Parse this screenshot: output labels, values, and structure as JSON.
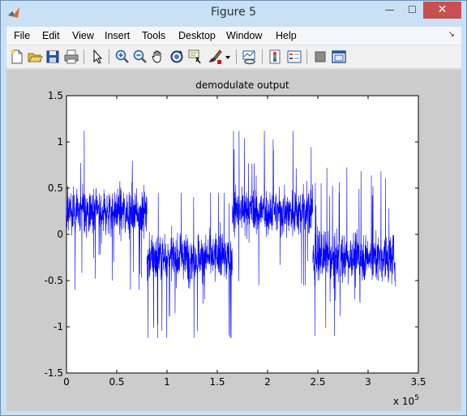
{
  "window": {
    "title": "Figure 5",
    "controls": {
      "minimize": "—",
      "maximize": "☐",
      "close": "✕"
    }
  },
  "menu": {
    "items": [
      "File",
      "Edit",
      "View",
      "Insert",
      "Tools",
      "Desktop",
      "Window",
      "Help"
    ],
    "dock_arrow": "↘"
  },
  "toolbar": {
    "buttons": [
      "new-figure-icon",
      "open-file-icon",
      "save-icon",
      "print-icon",
      "edit-plot-arrow-icon",
      "zoom-in-icon",
      "zoom-out-icon",
      "pan-hand-icon",
      "rotate-3d-icon",
      "data-cursor-icon",
      "brush-icon",
      "brush-dropdown-icon",
      "link-plot-icon",
      "insert-colorbar-icon",
      "insert-legend-icon",
      "hide-plot-tools-icon",
      "show-plot-tools-icon"
    ]
  },
  "chart_data": {
    "type": "line",
    "title": "demodulate output",
    "xlabel": "",
    "ylabel": "",
    "x_exponent_label": "x 10",
    "x_exponent_power": "5",
    "xlim": [
      0,
      3.5
    ],
    "ylim": [
      -1.5,
      1.5
    ],
    "x_ticks": [
      0,
      0.5,
      1,
      1.5,
      2,
      2.5,
      3,
      3.5
    ],
    "x_tick_labels": [
      "0",
      "0.5",
      "1",
      "1.5",
      "2",
      "2.5",
      "3",
      "3.5"
    ],
    "y_ticks": [
      -1.5,
      -1,
      -0.5,
      0,
      0.5,
      1,
      1.5
    ],
    "y_tick_labels": [
      "-1.5",
      "-1",
      "-0.5",
      "0",
      "0.5",
      "1",
      "1.5"
    ],
    "grid": false,
    "line_color": "#0000ff",
    "series": [
      {
        "segments": [
          {
            "x_range": [
              0,
              0.8
            ],
            "mean": 0.25,
            "extent": [
              -0.6,
              1.12
            ]
          },
          {
            "x_range": [
              0.8,
              1.65
            ],
            "mean": -0.25,
            "extent": [
              -1.12,
              0.45
            ]
          },
          {
            "x_range": [
              1.65,
              2.45
            ],
            "mean": 0.25,
            "extent": [
              -0.55,
              1.12
            ]
          },
          {
            "x_range": [
              2.45,
              3.27
            ],
            "mean": -0.25,
            "extent": [
              -1.1,
              0.9
            ]
          }
        ]
      }
    ]
  }
}
